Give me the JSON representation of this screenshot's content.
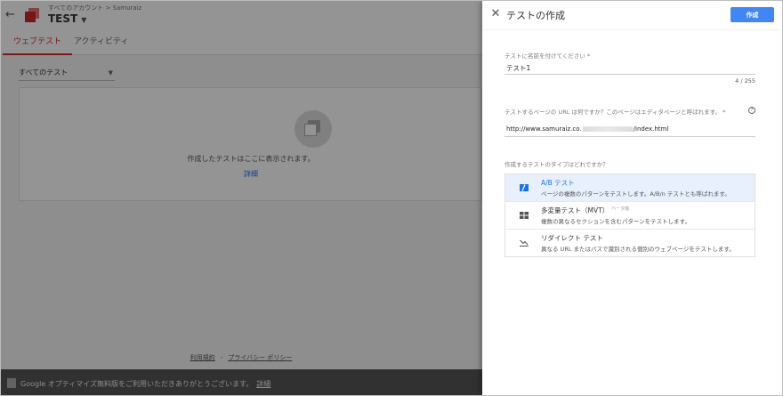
{
  "background": {
    "breadcrumb": "すべてのアカウント > Samuraiz",
    "container_title": "TEST",
    "tabs": [
      "ウェブテスト",
      "アクティビティ"
    ],
    "filter_label": "すべてのテスト",
    "empty_state_text": "作成したテストはここに表示されます。",
    "empty_state_link": "詳細",
    "footer_terms": "利用規約",
    "footer_separator": "-",
    "footer_privacy": "プライバシー ポリシー",
    "bottom_message": "Google オプティマイズ無料版をご利用いただきありがとうございます。",
    "bottom_link": "詳細"
  },
  "panel": {
    "title": "テストの作成",
    "create_button": "作成",
    "name_field": {
      "label": "テストに名前を付けてください *",
      "value": "テスト1",
      "counter": "4 / 255"
    },
    "url_field": {
      "label": "テストするページの URL は何ですか？このページはエディタページと呼ばれます。 *",
      "help_symbol": "?",
      "value_prefix": "http://www.samuraiz.co.",
      "value_suffix": "/index.html"
    },
    "type_question": "作成するテストのタイプはどれですか？",
    "types": [
      {
        "name": "A/B テスト",
        "badge": "",
        "description": "ページの複数のパターンをテストします。A/B/n テストとも呼ばれます。",
        "icon": "ab-test-icon",
        "selected": true
      },
      {
        "name": "多変量テスト（MVT）",
        "badge": "ベータ版",
        "description": "複数の異なるセクションを含むパターンをテストします。",
        "icon": "grid-icon",
        "selected": false
      },
      {
        "name": "リダイレクト テスト",
        "badge": "",
        "description": "異なる URL またはパスで識別される個別のウェブページをテストします。",
        "icon": "redirect-icon",
        "selected": false
      }
    ]
  },
  "colors": {
    "accent_red": "#d32f2f",
    "primary_blue": "#4285f4",
    "link_blue": "#1a73e8"
  }
}
